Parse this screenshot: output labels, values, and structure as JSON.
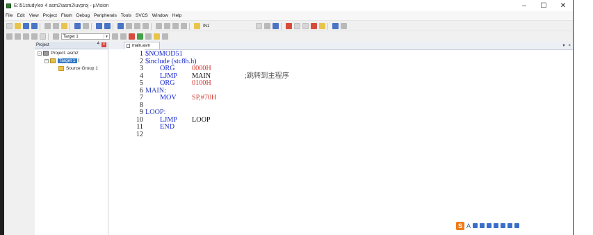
{
  "window": {
    "title": "E:\\51study\\ex 4 asm2\\asm2\\uvproj - µVision",
    "controls": [
      "–",
      "☐",
      "✕"
    ]
  },
  "menu": [
    "File",
    "Edit",
    "View",
    "Project",
    "Flash",
    "Debug",
    "Peripherals",
    "Tools",
    "SVCS",
    "Window",
    "Help"
  ],
  "toolbar": {
    "target_combo": "IN1",
    "target_select": "Target 1"
  },
  "project_pane": {
    "title": "Project",
    "pin": "4",
    "close": "x",
    "tree": {
      "project": "Project: asm2",
      "target": "Target 1",
      "group": "Source Group 1"
    }
  },
  "editor": {
    "tab": "main.asm",
    "tab_controls": [
      "▾",
      "×"
    ],
    "lines": [
      {
        "n": "1",
        "a": "$NOMOD51",
        "a_class": "c-kw"
      },
      {
        "n": "2",
        "a": "$include (stc8h.h)",
        "a_class": "c-kw"
      },
      {
        "n": "3",
        "b": "ORG",
        "c": "0000H",
        "c_class": "c-val"
      },
      {
        "n": "4",
        "b": "LJMP",
        "c": "MAIN",
        "c_class": "c-op",
        "d": ";跳转到主程序"
      },
      {
        "n": "5",
        "b": "ORG",
        "c": "0100H",
        "c_class": "c-val"
      },
      {
        "n": "6",
        "a": "MAIN:",
        "a_class": "c-label"
      },
      {
        "n": "7",
        "b": "MOV",
        "c": "SP,#70H",
        "c_class": "c-val"
      },
      {
        "n": "8"
      },
      {
        "n": "9",
        "a": "LOOP:",
        "a_class": "c-label"
      },
      {
        "n": "10",
        "b": "LJMP",
        "c": "LOOP",
        "c_class": "c-op"
      },
      {
        "n": "11",
        "b": "END"
      },
      {
        "n": "12"
      }
    ]
  },
  "ime": {
    "logo": "S",
    "mode": "A"
  }
}
